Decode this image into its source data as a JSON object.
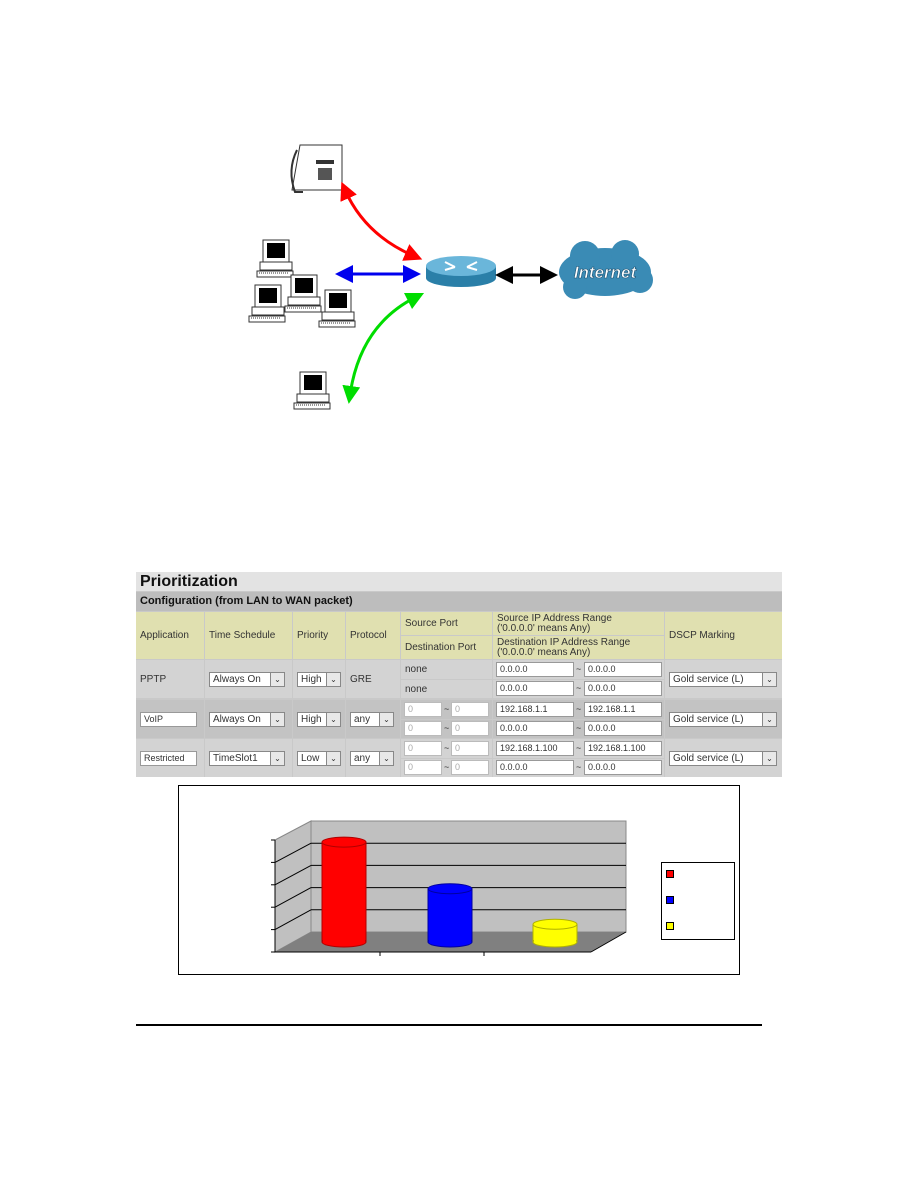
{
  "diagram": {
    "cloud_label": "Internet",
    "arrow_colors": {
      "phone": "#ff0000",
      "pcs": "#0000ee",
      "pc": "#00dd00",
      "internet": "#000000"
    }
  },
  "qos": {
    "title": "Prioritization",
    "subtitle": "Configuration (from LAN to WAN packet)",
    "headers": {
      "application": "Application",
      "time_schedule": "Time Schedule",
      "priority": "Priority",
      "protocol": "Protocol",
      "source_port": "Source Port",
      "destination_port": "Destination Port",
      "source_ip": "Source IP Address Range",
      "source_ip_note": "('0.0.0.0' means Any)",
      "destination_ip": "Destination IP Address Range",
      "destination_ip_note": "('0.0.0.0' means Any)",
      "dscp": "DSCP Marking"
    },
    "rows": [
      {
        "application": "PPTP",
        "time_schedule": "Always On",
        "priority": "High",
        "protocol": "GRE",
        "src_port": "none",
        "dst_port": "none",
        "src_ip_from": "0.0.0.0",
        "src_ip_to": "0.0.0.0",
        "dst_ip_from": "0.0.0.0",
        "dst_ip_to": "0.0.0.0",
        "dscp": "Gold service (L)"
      },
      {
        "application": "VoIP",
        "time_schedule": "Always On",
        "priority": "High",
        "protocol": "any",
        "src_port_from": "0",
        "src_port_to": "0",
        "dst_port_from": "0",
        "dst_port_to": "0",
        "src_ip_from": "192.168.1.1",
        "src_ip_to": "192.168.1.1",
        "dst_ip_from": "0.0.0.0",
        "dst_ip_to": "0.0.0.0",
        "dscp": "Gold service (L)"
      },
      {
        "application": "Restricted",
        "time_schedule": "TimeSlot1",
        "priority": "Low",
        "protocol": "any",
        "src_port_from": "0",
        "src_port_to": "0",
        "dst_port_from": "0",
        "dst_port_to": "0",
        "src_ip_from": "192.168.1.100",
        "src_ip_to": "192.168.1.100",
        "dst_ip_from": "0.0.0.0",
        "dst_ip_to": "0.0.0.0",
        "dscp": "Gold service (L)"
      }
    ],
    "tilde": "~",
    "dropdown_arrow": "chevron-down-icon"
  },
  "chart_data": {
    "type": "bar",
    "style": "3d-cylinder",
    "categories": [
      "",
      "",
      ""
    ],
    "series": [
      {
        "values": [
          4.5,
          null,
          null
        ],
        "color": "#ff0000"
      },
      {
        "values": [
          null,
          2.4,
          null
        ],
        "color": "#0000ff"
      },
      {
        "values": [
          null,
          null,
          0.8
        ],
        "color": "#ffff00"
      }
    ],
    "values": [
      4.5,
      2.4,
      0.8
    ],
    "colors": [
      "#ff0000",
      "#0000ff",
      "#ffff00"
    ],
    "ylim": [
      0,
      5
    ],
    "grid": true,
    "legend": "right",
    "wall_color": "#c0c0c0",
    "floor_color": "#808080"
  }
}
